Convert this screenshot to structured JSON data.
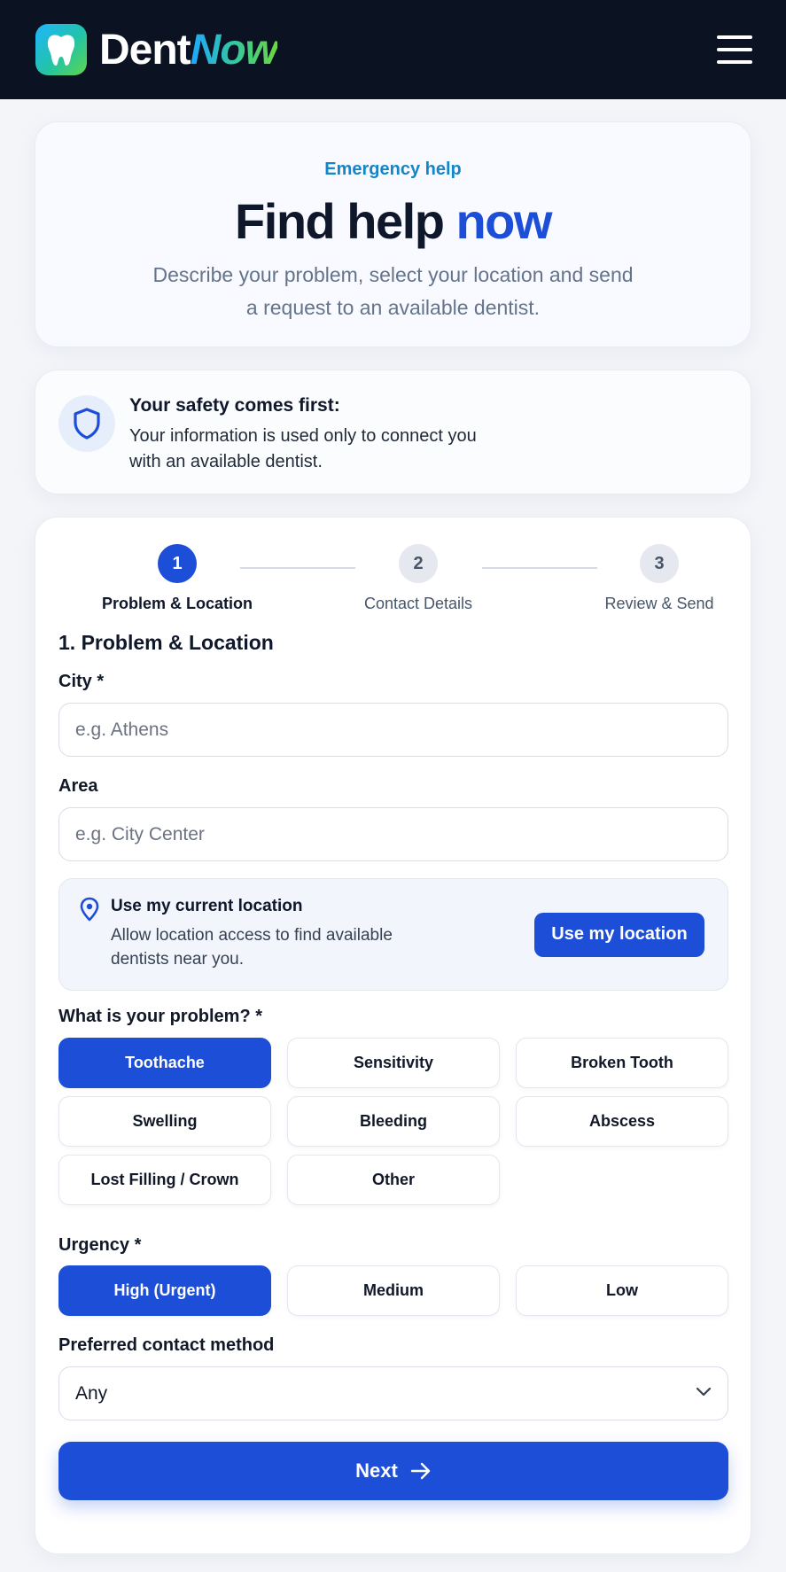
{
  "brand": {
    "name_part1": "Dent",
    "name_part2": "Now"
  },
  "header": {
    "menu_icon": "hamburger-menu-icon"
  },
  "hero": {
    "eyebrow": "Emergency help",
    "title_part1": "Find help",
    "title_accent": "now",
    "subtitle": "Describe your problem, select your location and send a request to an available dentist."
  },
  "safety": {
    "icon": "shield-icon",
    "title": "Your safety comes first:",
    "body": "Your information is used only to connect you with an available dentist."
  },
  "stepper": {
    "steps": [
      {
        "number": "1",
        "label": "Problem & Location",
        "active": true
      },
      {
        "number": "2",
        "label": "Contact Details",
        "active": false
      },
      {
        "number": "3",
        "label": "Review & Send",
        "active": false
      }
    ]
  },
  "form": {
    "section_title": "1. Problem & Location",
    "city": {
      "label": "City *",
      "placeholder": "e.g. Athens",
      "value": ""
    },
    "area": {
      "label": "Area",
      "placeholder": "e.g. City Center",
      "value": ""
    },
    "location": {
      "icon": "map-pin-icon",
      "title": "Use my current location",
      "body": "Allow location access to find available dentists near you.",
      "button_label": "Use my location"
    },
    "problem": {
      "label": "What is your problem? *",
      "options": [
        "Toothache",
        "Sensitivity",
        "Broken Tooth",
        "Swelling",
        "Bleeding",
        "Abscess",
        "Lost Filling / Crown",
        "Other"
      ],
      "selected": "Toothache"
    },
    "urgency": {
      "label": "Urgency *",
      "options": [
        "High (Urgent)",
        "Medium",
        "Low"
      ],
      "selected": "High (Urgent)"
    },
    "contact_method": {
      "label": "Preferred contact method",
      "value": "Any",
      "icon": "chevron-down-icon"
    },
    "next_button": {
      "label": "Next",
      "icon": "arrow-right-icon"
    }
  },
  "colors": {
    "primary": "#1d4ed8",
    "header_bg": "#0b1222",
    "eyebrow": "#1585c9",
    "page_bg": "#f3f5f9"
  }
}
